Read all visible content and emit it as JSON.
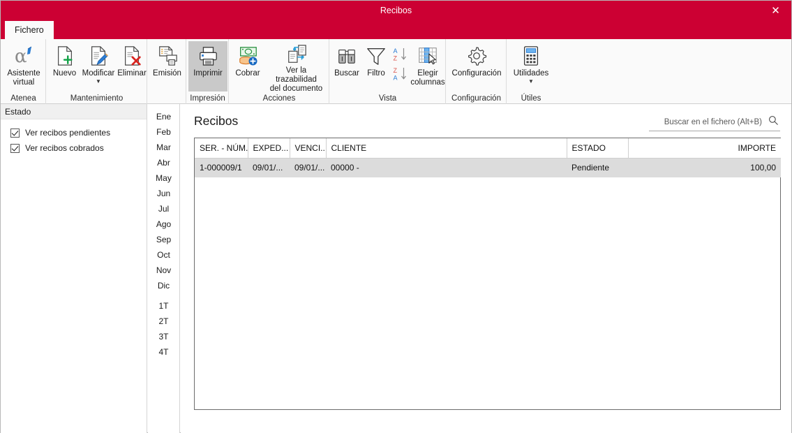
{
  "window": {
    "title": "Recibos",
    "close_label": "✕"
  },
  "tabs": [
    {
      "label": "Fichero",
      "active": true
    }
  ],
  "ribbon": {
    "groups": [
      {
        "name": "atenea",
        "label": "Atenea",
        "buttons": [
          {
            "name": "asistente-virtual",
            "label": "Asistente\nvirtual",
            "icon": "alpha-icon",
            "caret": false,
            "active": false
          }
        ]
      },
      {
        "name": "mantenimiento",
        "label": "Mantenimiento",
        "buttons": [
          {
            "name": "nuevo",
            "label": "Nuevo",
            "icon": "new-document-icon",
            "caret": false,
            "active": false
          },
          {
            "name": "modificar",
            "label": "Modificar",
            "icon": "edit-document-icon",
            "caret": true,
            "active": false
          },
          {
            "name": "eliminar",
            "label": "Eliminar",
            "icon": "delete-document-icon",
            "caret": false,
            "active": false
          }
        ]
      },
      {
        "name": "impresion-emision",
        "label": "",
        "buttons": [
          {
            "name": "emision",
            "label": "Emisión",
            "icon": "emission-icon",
            "caret": false,
            "active": false
          }
        ]
      },
      {
        "name": "impresion",
        "label": "Impresión",
        "buttons": [
          {
            "name": "imprimir",
            "label": "Imprimir",
            "icon": "printer-icon",
            "caret": false,
            "active": true
          }
        ]
      },
      {
        "name": "acciones",
        "label": "Acciones",
        "buttons": [
          {
            "name": "cobrar",
            "label": "Cobrar",
            "icon": "money-icon",
            "caret": false,
            "active": false
          },
          {
            "name": "ver-trazabilidad",
            "label": "Ver la trazabilidad\ndel documento",
            "icon": "traceability-icon",
            "caret": false,
            "active": false
          }
        ]
      },
      {
        "name": "vista",
        "label": "Vista",
        "buttons": [
          {
            "name": "buscar",
            "label": "Buscar",
            "icon": "binoculars-icon",
            "caret": false,
            "active": false
          },
          {
            "name": "filtro",
            "label": "Filtro",
            "icon": "funnel-icon",
            "caret": false,
            "active": false
          },
          {
            "name": "ordenar-az",
            "label": "",
            "icon": "sort-az-icon",
            "caret": false,
            "active": false
          },
          {
            "name": "ordenar-za",
            "label": "",
            "icon": "sort-za-icon",
            "caret": false,
            "active": false
          },
          {
            "name": "elegir-columnas",
            "label": "Elegir\ncolumnas",
            "icon": "choose-columns-icon",
            "caret": false,
            "active": false
          }
        ]
      },
      {
        "name": "configuracion",
        "label": "Configuración",
        "buttons": [
          {
            "name": "configuracion",
            "label": "Configuración",
            "icon": "gear-icon",
            "caret": false,
            "active": false
          }
        ]
      },
      {
        "name": "utiles",
        "label": "Útiles",
        "buttons": [
          {
            "name": "utilidades",
            "label": "Utilidades",
            "icon": "calculator-icon",
            "caret": true,
            "active": false
          }
        ]
      }
    ]
  },
  "filter_panel": {
    "header": "Estado",
    "checkboxes": [
      {
        "label": "Ver recibos pendientes",
        "checked": true
      },
      {
        "label": "Ver recibos cobrados",
        "checked": true
      }
    ]
  },
  "month_strip": {
    "months": [
      "Ene",
      "Feb",
      "Mar",
      "Abr",
      "May",
      "Jun",
      "Jul",
      "Ago",
      "Sep",
      "Oct",
      "Nov",
      "Dic"
    ],
    "quarters": [
      "1T",
      "2T",
      "3T",
      "4T"
    ]
  },
  "main": {
    "title": "Recibos",
    "search_placeholder": "Buscar en el fichero (Alt+B)",
    "search_value": "",
    "table": {
      "columns": [
        {
          "key": "ser_num",
          "label": "SER. - NÚM.",
          "align": "left"
        },
        {
          "key": "expedicion",
          "label": "EXPED...",
          "align": "left"
        },
        {
          "key": "vencimiento",
          "label": "VENCI...",
          "align": "left"
        },
        {
          "key": "cliente",
          "label": "CLIENTE",
          "align": "left"
        },
        {
          "key": "estado",
          "label": "ESTADO",
          "align": "left"
        },
        {
          "key": "importe",
          "label": "IMPORTE",
          "align": "right"
        }
      ],
      "rows": [
        {
          "selected": true,
          "ser_num": "1-000009/1",
          "expedicion": "09/01/...",
          "vencimiento": "09/01/...",
          "cliente": "00000 -",
          "estado": "Pendiente",
          "importe": "100,00"
        }
      ]
    }
  },
  "colors": {
    "brand_red": "#cc0033",
    "ribbon_bg": "#fafafa",
    "selected_row": "#dcdcdc",
    "active_button": "#c9c9c9"
  }
}
